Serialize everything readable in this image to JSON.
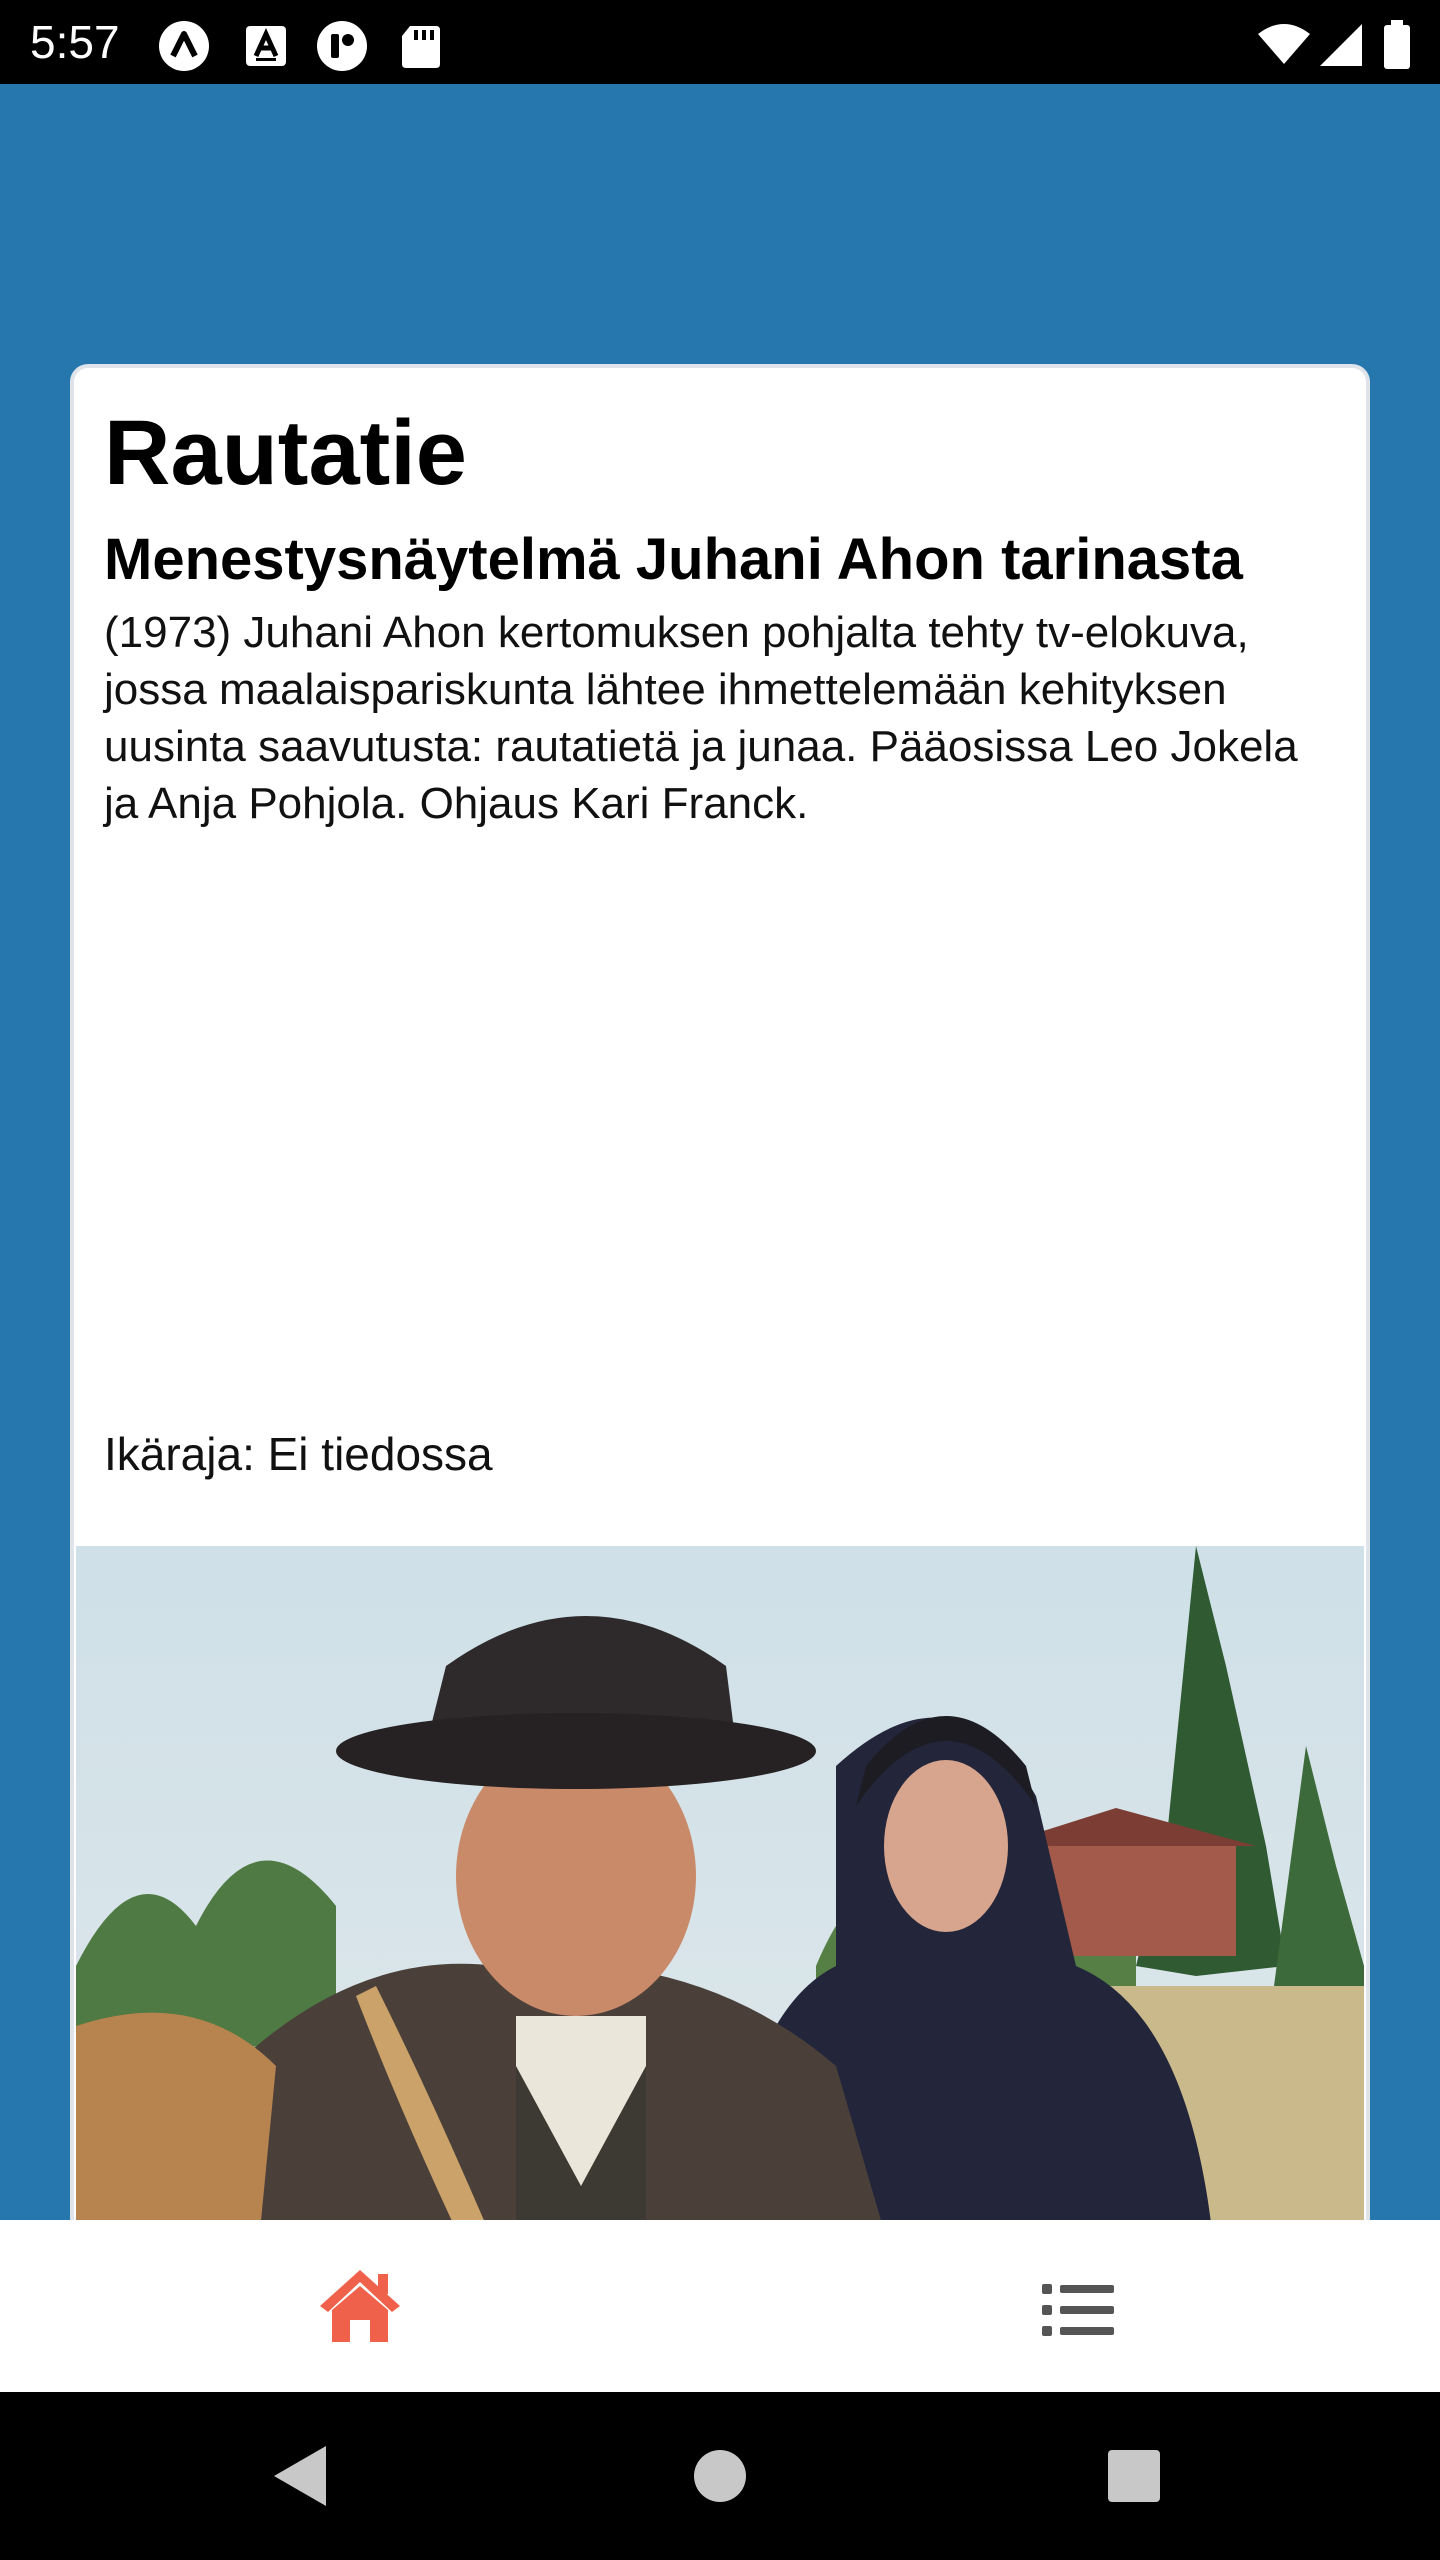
{
  "status_bar": {
    "time": "5:57",
    "left_icons": [
      "expo-icon",
      "a-font-icon",
      "sync-badge-icon",
      "sd-card-icon"
    ],
    "right_icons": [
      "wifi-icon",
      "cell-signal-icon",
      "battery-icon"
    ]
  },
  "card": {
    "title": "Rautatie",
    "subtitle": "Menestysnäytelmä Juhani Ahon tarinasta",
    "description": "(1973) Juhani Ahon kertomuksen pohjalta tehty tv-elokuva, jossa maalaispariskunta lähtee ihmettelemään kehityksen uusinta saavutusta: rautatietä ja junaa. Pääosissa Leo Jokela ja Anja Pohjola. Ohjaus Kari Franck.",
    "age_rating": "Ikäraja: Ei tiedossa"
  },
  "tab_bar": {
    "active_color": "#f0614b",
    "inactive_color": "#555555",
    "tabs": [
      {
        "icon": "home-icon",
        "active": true
      },
      {
        "icon": "list-icon",
        "active": false
      }
    ]
  },
  "nav_bar": {
    "buttons": [
      "back-icon",
      "home-circle-icon",
      "recents-icon"
    ]
  },
  "colors": {
    "app_background": "#2677ae",
    "card_background": "#ffffff"
  }
}
